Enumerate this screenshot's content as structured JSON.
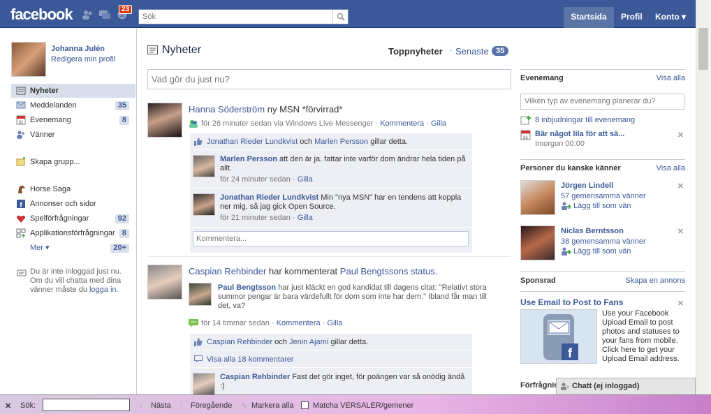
{
  "header": {
    "logo": "facebook",
    "notif_count": "23",
    "search_placeholder": "Sök",
    "nav": {
      "home": "Startsida",
      "profile": "Profil",
      "account": "Konto ▾"
    }
  },
  "user": {
    "name": "Johanna Julén",
    "edit": "Redigera min profil"
  },
  "sidebar": {
    "items": [
      {
        "label": "Nyheter",
        "count": ""
      },
      {
        "label": "Meddelanden",
        "count": "35"
      },
      {
        "label": "Evenemang",
        "count": "8"
      },
      {
        "label": "Vänner",
        "count": ""
      },
      {
        "label": "Skapa grupp...",
        "count": ""
      },
      {
        "label": "Horse Saga",
        "count": ""
      },
      {
        "label": "Annonser och sidor",
        "count": ""
      },
      {
        "label": "Spelförfrågningar",
        "count": "92"
      },
      {
        "label": "Applikationsförfrågningar",
        "count": "8"
      },
      {
        "label": "Mer ▾",
        "count": "20+"
      }
    ],
    "chat_offline_1": "Du är inte inloggad just nu. Om du vill chatta med dina vänner måste du ",
    "chat_offline_link": "logga in",
    "chat_offline_2": "."
  },
  "feed": {
    "title": "Nyheter",
    "tab_top": "Toppnyheter",
    "tab_dot": "·",
    "tab_recent": "Senaste",
    "tab_count": "35",
    "status_placeholder": "Vad gör du just nu?",
    "story1": {
      "name": "Hanna Söderström",
      "text": " ny MSN *förvirrad*",
      "time": "för 26 minuter sedan via Windows Live Messenger",
      "comment": "Kommentera",
      "like": "Gilla",
      "sep": "·",
      "likes_a": "Jonathan Rieder Lundkvist",
      "likes_and": " och ",
      "likes_b": "Marlen Persson",
      "likes_tail": " gillar detta.",
      "comments": [
        {
          "name": "Marlen Persson",
          "text": " att den är ja. fattar inte varför dom ändrar hela tiden på allt.",
          "time": "för 24 minuter sedan",
          "like": "Gilla"
        },
        {
          "name": "Jonathan Rieder Lundkvist",
          "text": " Min \"nya MSN\" har en tendens att koppla ner mig, så jag gick Open Source.",
          "time": "för 21 minuter sedan",
          "like": "Gilla"
        }
      ],
      "comment_placeholder": "Kommentera..."
    },
    "story2": {
      "name": "Caspian Rehbinder",
      "text": " har kommenterat ",
      "link": "Paul Bengtssons status.",
      "quote_name": "Paul Bengtsson",
      "quote_text": " har just kläckt en god kandidat till dagens citat: \"Relativt stora summor pengar är bara värdefullt för dom som inte har dem.\" Ibland får man till det, va?",
      "time": "för 14 timmar sedan",
      "comment": "Kommentera",
      "like": "Gilla",
      "sep": "·",
      "likes_a": "Caspian Rehbinder",
      "likes_and": " och ",
      "likes_b": "Jenin Ajami",
      "likes_tail": " gillar detta.",
      "view_all": "Visa alla 18 kommentarer",
      "c_name": "Caspian Rehbinder",
      "c_text": " Fast det gör inget, för poängen var så onödig ändå :)"
    }
  },
  "right": {
    "events": {
      "title": "Evenemang",
      "more": "Visa alla",
      "placeholder": "Vilken typ av evenemang planerar du?",
      "invites": "8 inbjudningar till evenemang",
      "event_name": "Bär något lila för att sä...",
      "event_time": "Imorgon 00:00"
    },
    "pyk": {
      "title": "Personer du kanske känner",
      "more": "Visa alla",
      "people": [
        {
          "name": "Jörgen Lindell",
          "mutual": "57 gemensamma vänner",
          "add": "Lägg till som vän"
        },
        {
          "name": "Niclas Berntsson",
          "mutual": "38 gemensamma vänner",
          "add": "Lägg till som vän"
        }
      ]
    },
    "sponsored": {
      "title": "Sponsrad",
      "more": "Skapa en annons",
      "ad_title": "Use Email to Post to Fans",
      "ad_text": "Use your Facebook Upload Email to post photos and statuses to your fans from mobile. Click here to get your Upload Email address."
    }
  },
  "chat": {
    "requests": "Förfrågningar",
    "label": "Chatt (ej inloggad)"
  },
  "findbar": {
    "close": "✕",
    "label": "Sök:",
    "next": "Nästa",
    "prev": "Föregående",
    "highlight": "Markera alla",
    "match_case": "Matcha VERSALER/gemener"
  }
}
